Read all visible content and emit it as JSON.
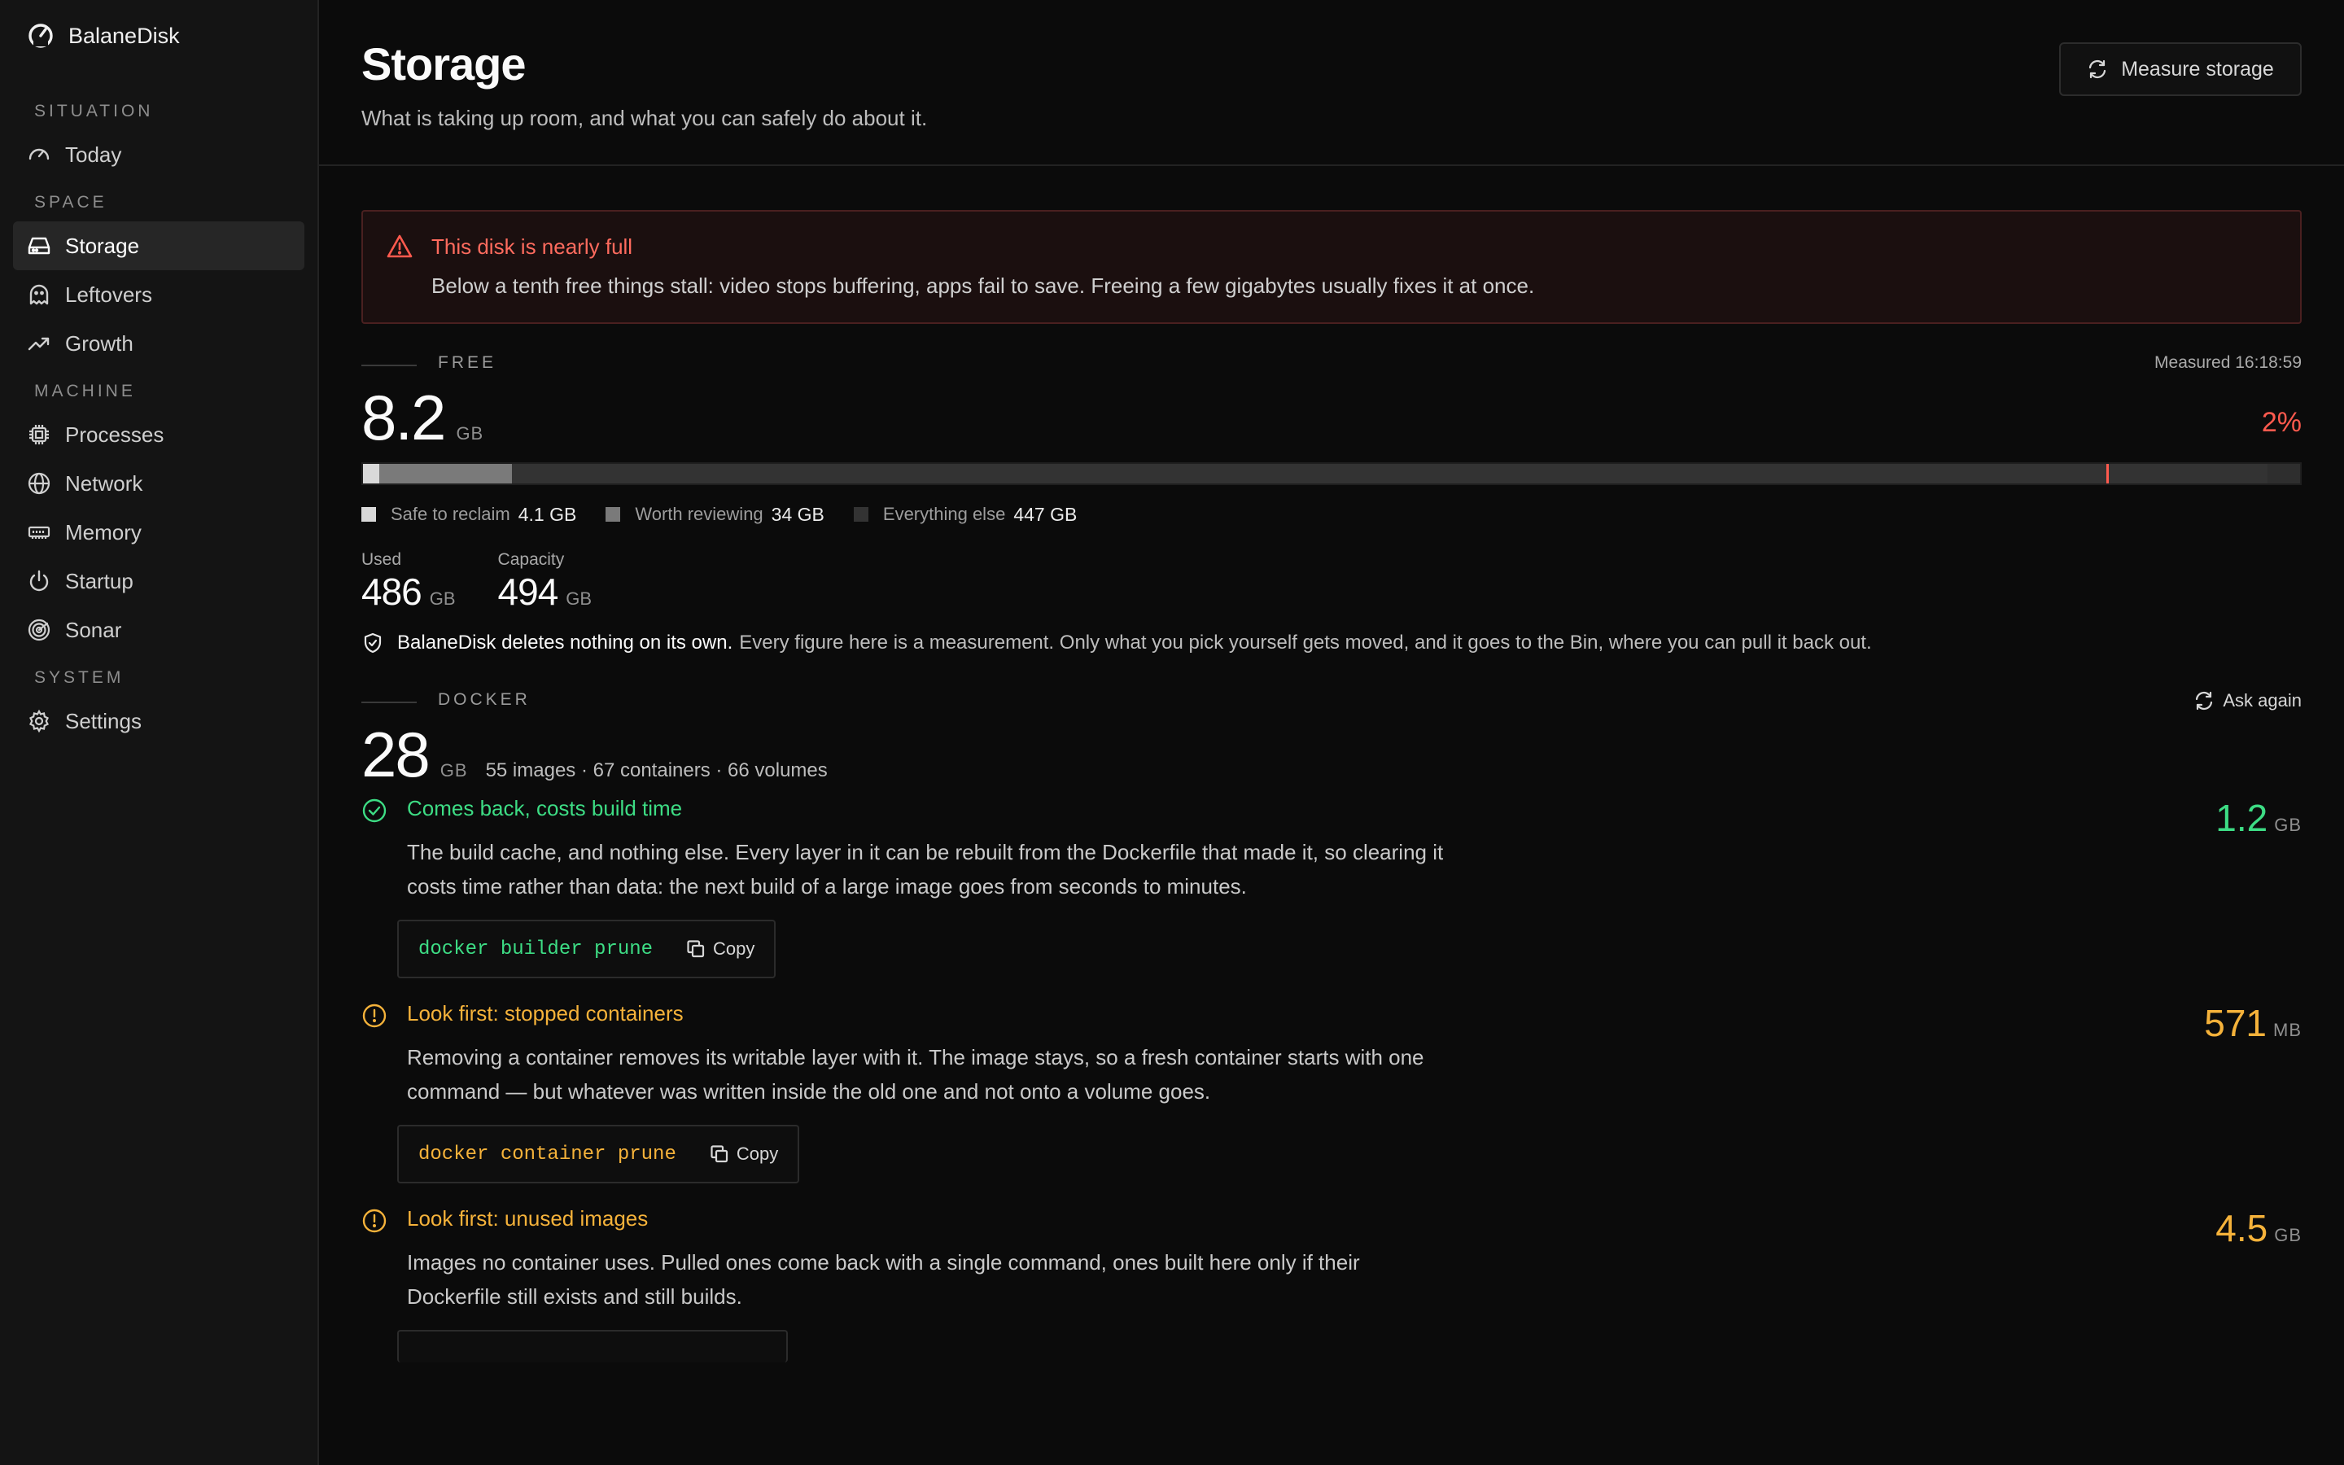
{
  "app": {
    "name": "BalaneDisk"
  },
  "sidebar": {
    "sections": [
      {
        "label": "SITUATION",
        "items": [
          {
            "label": "Today",
            "icon": "gauge-icon"
          }
        ]
      },
      {
        "label": "SPACE",
        "items": [
          {
            "label": "Storage",
            "icon": "drive-icon",
            "active": true
          },
          {
            "label": "Leftovers",
            "icon": "ghost-icon"
          },
          {
            "label": "Growth",
            "icon": "trend-up-icon"
          }
        ]
      },
      {
        "label": "MACHINE",
        "items": [
          {
            "label": "Processes",
            "icon": "cpu-icon"
          },
          {
            "label": "Network",
            "icon": "globe-icon"
          },
          {
            "label": "Memory",
            "icon": "memory-icon"
          },
          {
            "label": "Startup",
            "icon": "power-icon"
          },
          {
            "label": "Sonar",
            "icon": "radar-icon"
          }
        ]
      },
      {
        "label": "SYSTEM",
        "items": [
          {
            "label": "Settings",
            "icon": "gear-icon"
          }
        ]
      }
    ]
  },
  "header": {
    "title": "Storage",
    "subtitle": "What is taking up room, and what you can safely do about it.",
    "measure_label": "Measure storage"
  },
  "alert": {
    "title": "This disk is nearly full",
    "body": "Below a tenth free things stall: video stops buffering, apps fail to save. Freeing a few gigabytes usually fixes it at once."
  },
  "free": {
    "section_label": "FREE",
    "measured": "Measured 16:18:59",
    "value": "8.2",
    "unit": "GB",
    "percent": "2%",
    "bar": {
      "safe_fraction": 0.0083,
      "review_fraction": 0.0688,
      "used_fraction": 0.983,
      "threshold_fraction": 0.9
    },
    "legend": [
      {
        "label": "Safe to reclaim",
        "value": "4.1 GB",
        "color": "#d9d9d9"
      },
      {
        "label": "Worth reviewing",
        "value": "34 GB",
        "color": "#7a7a7a"
      },
      {
        "label": "Everything else",
        "value": "447 GB",
        "color": "#333333"
      }
    ],
    "used": {
      "label": "Used",
      "value": "486",
      "unit": "GB"
    },
    "capacity": {
      "label": "Capacity",
      "value": "494",
      "unit": "GB"
    }
  },
  "notice": {
    "strong": "BalaneDisk deletes nothing on its own.",
    "body": "Every figure here is a measurement. Only what you pick yourself gets moved, and it goes to the Bin, where you can pull it back out."
  },
  "docker": {
    "section_label": "DOCKER",
    "ask_again": "Ask again",
    "value": "28",
    "unit": "GB",
    "meta": "55 images · 67 containers · 66 volumes",
    "items": [
      {
        "title": "Comes back, costs build time",
        "body": "The build cache, and nothing else. Every layer in it can be rebuilt from the Dockerfile that made it, so clearing it costs time rather than data: the next build of a large image goes from seconds to minutes.",
        "command": "docker builder prune",
        "copy": "Copy",
        "size": "1.2",
        "size_unit": "GB",
        "tone": "green"
      },
      {
        "title": "Look first: stopped containers",
        "body": "Removing a container removes its writable layer with it. The image stays, so a fresh container starts with one command — but whatever was written inside the old one and not onto a volume goes.",
        "command": "docker container prune",
        "copy": "Copy",
        "size": "571",
        "size_unit": "MB",
        "tone": "amber"
      },
      {
        "title": "Look first: unused images",
        "body": "Images no container uses. Pulled ones come back with a single command, ones built here only if their Dockerfile still exists and still builds.",
        "size": "4.5",
        "size_unit": "GB",
        "tone": "amber"
      }
    ]
  },
  "colors": {
    "danger": "#ff5a4e",
    "safe": "#3ddc84",
    "caution": "#f5b23a"
  }
}
